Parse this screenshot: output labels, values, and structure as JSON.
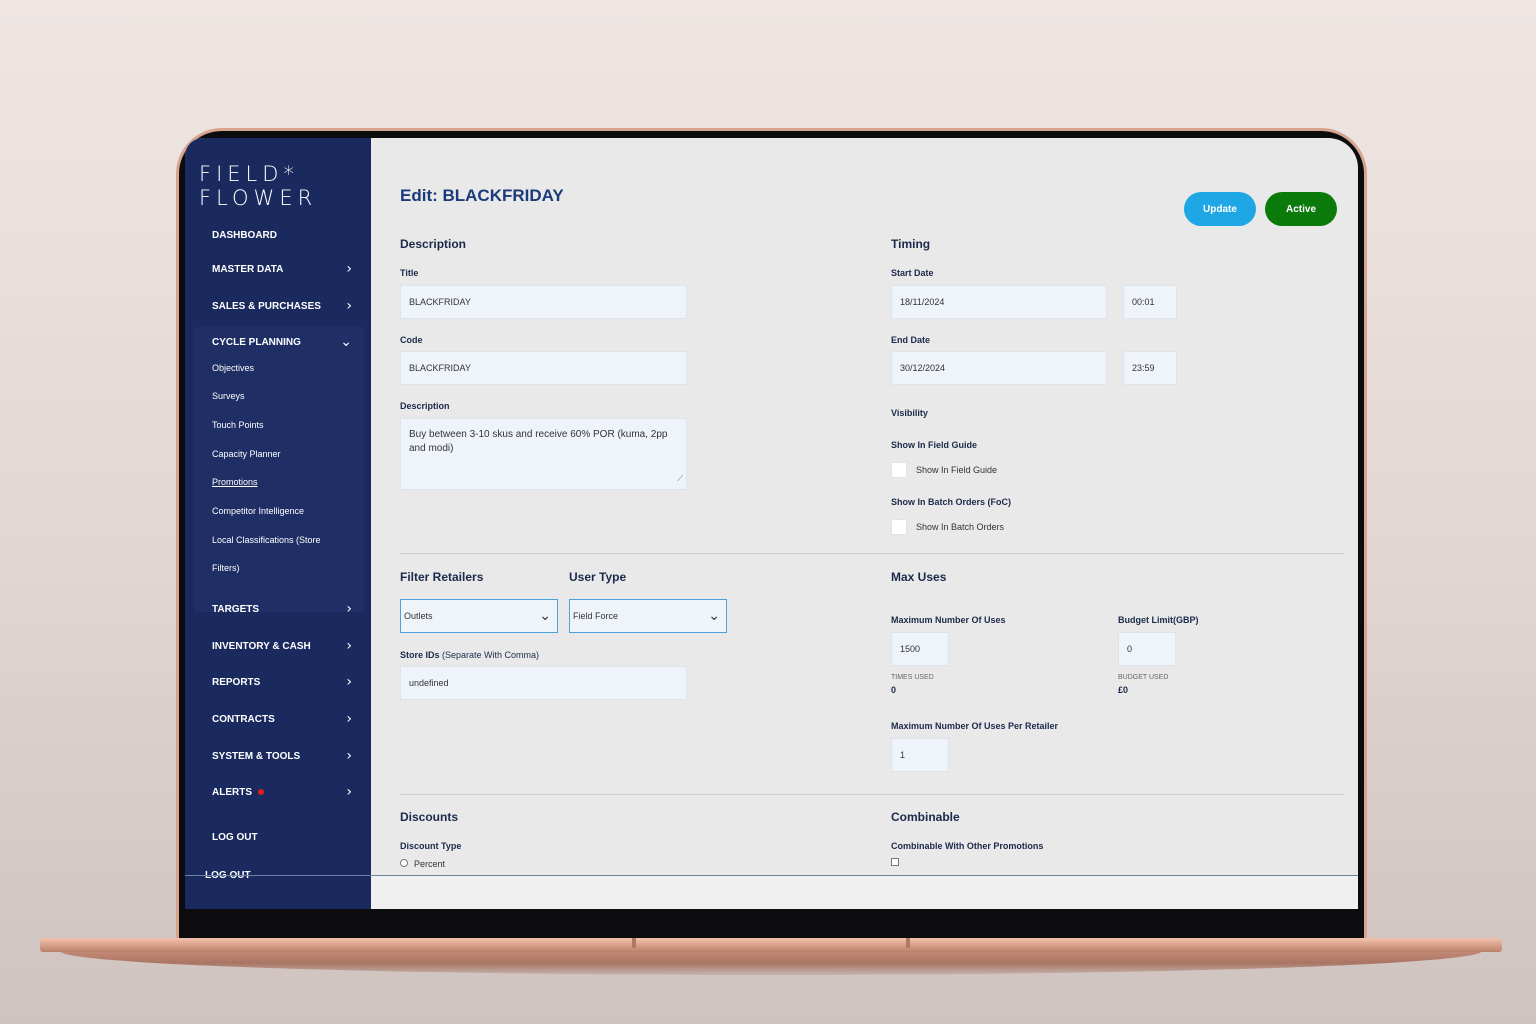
{
  "app": {
    "logo_line1": "FIELD*",
    "logo_line2": "FLOWER"
  },
  "sidebar": {
    "items": [
      {
        "label": "DASHBOARD"
      },
      {
        "label": "MASTER DATA"
      },
      {
        "label": "SALES & PURCHASES"
      },
      {
        "label": "CYCLE PLANNING"
      },
      {
        "label": "TARGETS"
      },
      {
        "label": "INVENTORY & CASH"
      },
      {
        "label": "REPORTS"
      },
      {
        "label": "CONTRACTS"
      },
      {
        "label": "SYSTEM & TOOLS"
      },
      {
        "label": "ALERTS"
      },
      {
        "label": "LOG OUT"
      }
    ],
    "sub_items": [
      {
        "label": "Objectives"
      },
      {
        "label": "Surveys"
      },
      {
        "label": "Touch Points"
      },
      {
        "label": "Capacity Planner"
      },
      {
        "label": "Promotions"
      },
      {
        "label": "Competitor Intelligence"
      },
      {
        "label": "Local Classifications (Store"
      },
      {
        "label": "Filters)"
      }
    ],
    "chevron_right": "›",
    "chevron_down": "⌄",
    "ghost_logout": "LOG OUT",
    "alert_color": "#e01b1b"
  },
  "header": {
    "title": "Edit: BLACKFRIDAY",
    "update_label": "Update",
    "active_label": "Active"
  },
  "description": {
    "section": "Description",
    "title_label": "Title",
    "title_value": "BLACKFRIDAY",
    "code_label": "Code",
    "code_value": "BLACKFRIDAY",
    "desc_label": "Description",
    "desc_value": "Buy between 3-10 skus and receive 60% POR (kuma, 2pp and modi)"
  },
  "timing": {
    "section": "Timing",
    "start_label": "Start Date",
    "start_date": "18/11/2024",
    "start_time": "00:01",
    "end_label": "End Date",
    "end_date": "30/12/2024",
    "end_time": "23:59"
  },
  "visibility": {
    "section": "Visibility",
    "field_guide_label": "Show In Field Guide",
    "field_guide_cb": "Show In Field Guide",
    "batch_label": "Show In Batch Orders (FoC)",
    "batch_cb": "Show In Batch Orders"
  },
  "filters": {
    "retailers_title": "Filter Retailers",
    "retailers_value": "Outlets",
    "user_type_title": "User Type",
    "user_type_value": "Field Force",
    "store_ids_label": "Store IDs",
    "store_ids_hint": "(Separate With Comma)",
    "store_ids_value": "undefined"
  },
  "max_uses": {
    "section": "Max Uses",
    "max_label": "Maximum Number Of Uses",
    "max_value": "1500",
    "times_used_label": "TIMES USED",
    "times_used_value": "0",
    "budget_label": "Budget Limit(GBP)",
    "budget_value": "0",
    "budget_used_label": "BUDGET USED",
    "budget_used_value": "£0",
    "per_retailer_label": "Maximum Number Of Uses Per Retailer",
    "per_retailer_value": "1"
  },
  "discounts": {
    "section": "Discounts",
    "type_label": "Discount Type",
    "percent_label": "Percent"
  },
  "combinable": {
    "section": "Combinable",
    "label": "Combinable With Other Promotions"
  },
  "colors": {
    "sidebar": "#1b2a5e",
    "update": "#1ea7e4",
    "active": "#0a7a0a",
    "title": "#1b3a7a"
  }
}
